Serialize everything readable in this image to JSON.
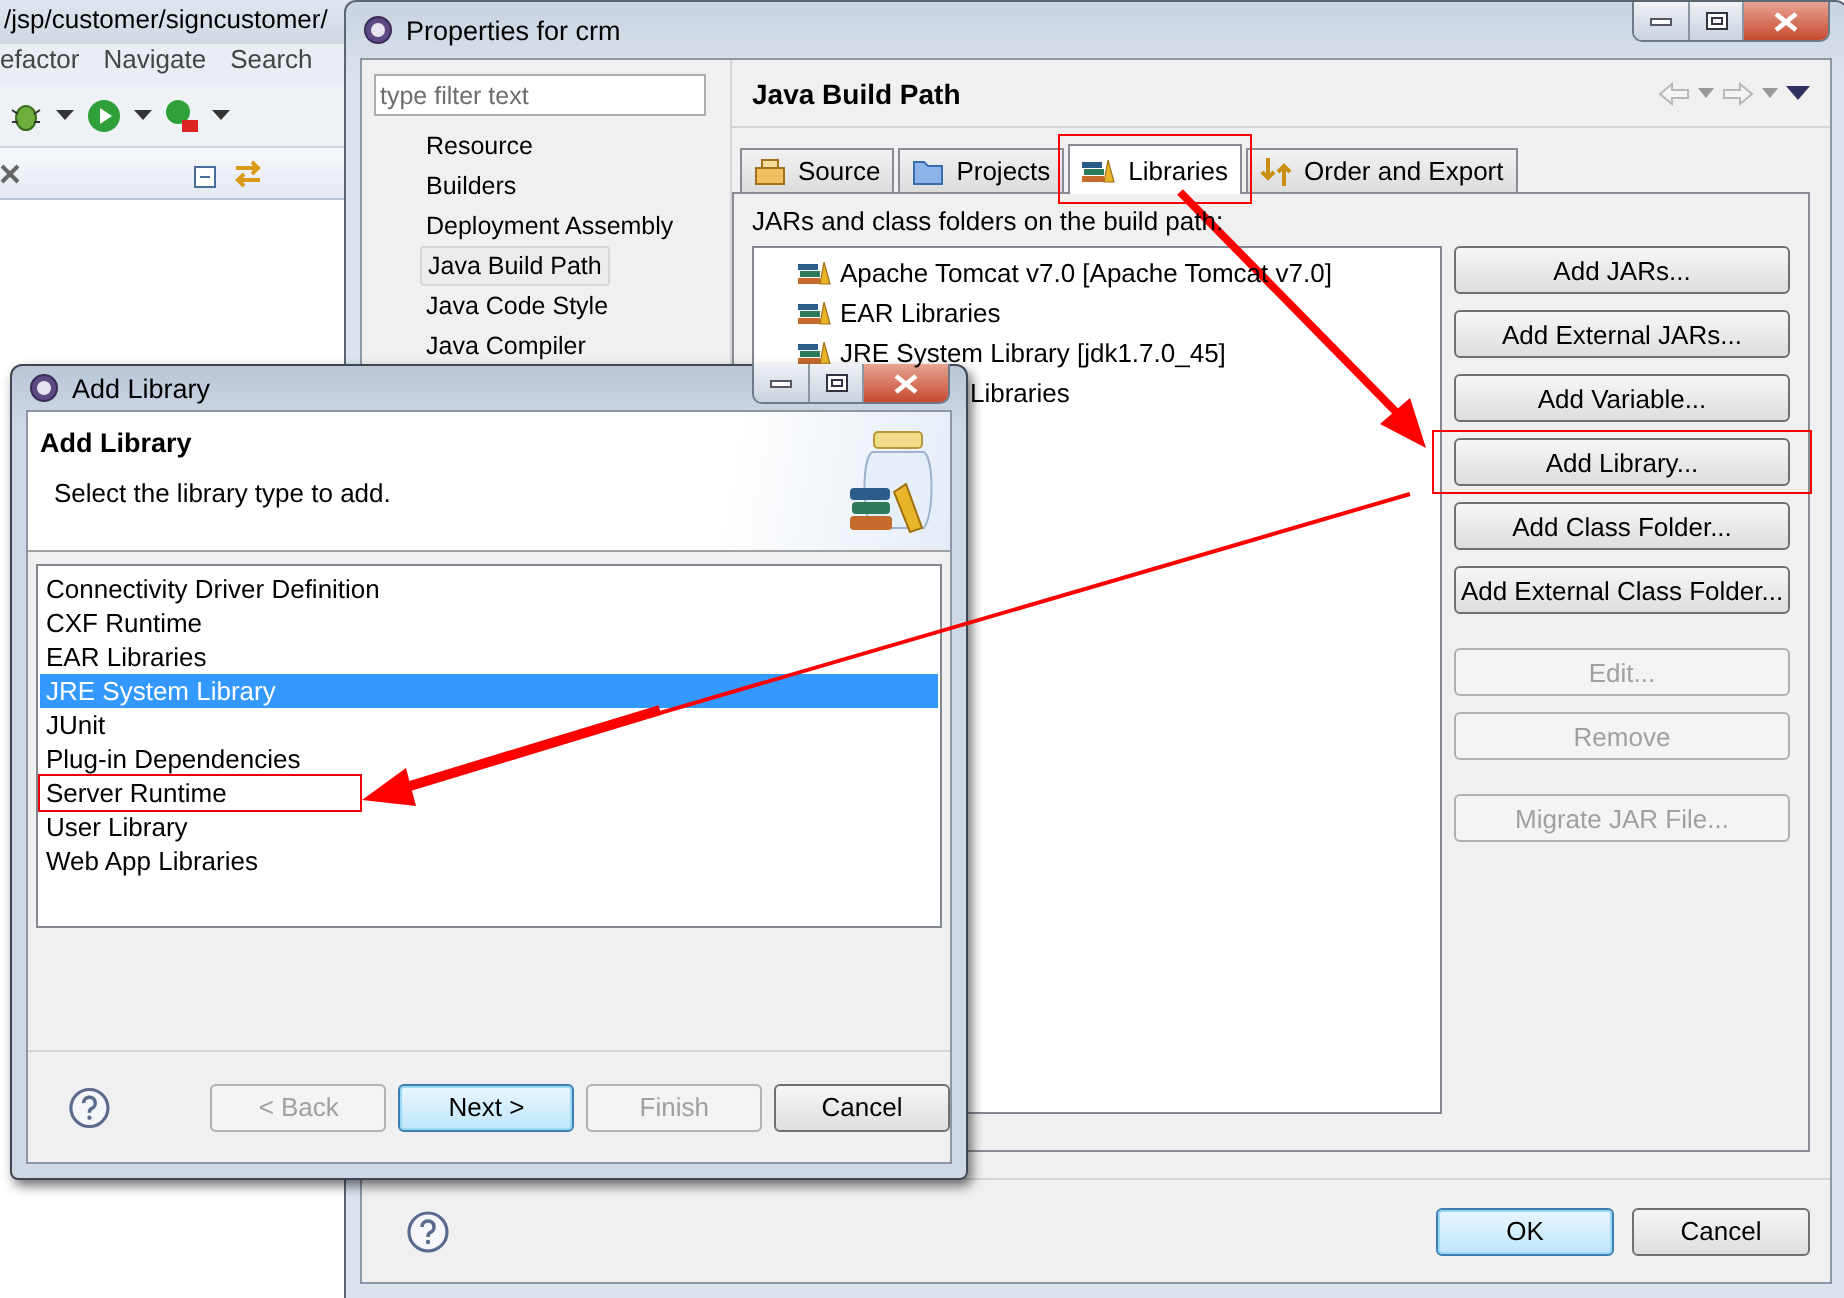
{
  "ide": {
    "path": "/jsp/customer/signcustomer/",
    "menu": [
      "efactor",
      "Navigate",
      "Search"
    ]
  },
  "properties_window": {
    "title": "Properties for crm",
    "filter": {
      "placeholder": "type filter text"
    },
    "nav_items": [
      {
        "label": "Resource",
        "selected": false
      },
      {
        "label": "Builders",
        "selected": false
      },
      {
        "label": "Deployment Assembly",
        "selected": false
      },
      {
        "label": "Java Build Path",
        "selected": true
      },
      {
        "label": "Java Code Style",
        "selected": false
      },
      {
        "label": "Java Compiler",
        "selected": false
      }
    ],
    "page_title": "Java Build Path",
    "tabs": [
      {
        "label": "Source",
        "kind": "source",
        "selected": false,
        "highlighted": false
      },
      {
        "label": "Projects",
        "kind": "projects",
        "selected": false,
        "highlighted": false
      },
      {
        "label": "Libraries",
        "kind": "libraries",
        "selected": true,
        "highlighted": true
      },
      {
        "label": "Order and Export",
        "kind": "order",
        "selected": false,
        "highlighted": false
      }
    ],
    "list_caption": "JARs and class folders on the build path:",
    "entries": [
      {
        "label": "Apache Tomcat v7.0 [Apache Tomcat v7.0]",
        "kind": "library"
      },
      {
        "label": "EAR Libraries",
        "kind": "library"
      },
      {
        "label": "JRE System Library [jdk1.7.0_45]",
        "kind": "library"
      },
      {
        "label": "Libraries",
        "kind": "covered"
      }
    ],
    "buttons": [
      {
        "label": "Add JARs...",
        "disabled": false,
        "highlighted": false
      },
      {
        "label": "Add External JARs...",
        "disabled": false,
        "highlighted": false
      },
      {
        "label": "Add Variable...",
        "disabled": false,
        "highlighted": false
      },
      {
        "label": "Add Library...",
        "disabled": false,
        "highlighted": true
      },
      {
        "label": "Add Class Folder...",
        "disabled": false,
        "highlighted": false
      },
      {
        "label": "Add External Class Folder...",
        "disabled": false,
        "highlighted": false
      },
      {
        "label": "Edit...",
        "disabled": true,
        "highlighted": false
      },
      {
        "label": "Remove",
        "disabled": true,
        "highlighted": false
      },
      {
        "label": "Migrate JAR File...",
        "disabled": true,
        "highlighted": false
      }
    ],
    "footer_buttons": [
      {
        "label": "OK",
        "default": true
      },
      {
        "label": "Cancel",
        "default": false
      }
    ]
  },
  "add_library_dialog": {
    "title": "Add Library",
    "heading": "Add Library",
    "description": "Select the library type to add.",
    "library_types": [
      {
        "label": "Connectivity Driver Definition",
        "selected": false,
        "highlighted": false
      },
      {
        "label": "CXF Runtime",
        "selected": false,
        "highlighted": false
      },
      {
        "label": "EAR Libraries",
        "selected": false,
        "highlighted": false
      },
      {
        "label": "JRE System Library",
        "selected": true,
        "highlighted": false
      },
      {
        "label": "JUnit",
        "selected": false,
        "highlighted": false
      },
      {
        "label": "Plug-in Dependencies",
        "selected": false,
        "highlighted": false
      },
      {
        "label": "Server Runtime",
        "selected": false,
        "highlighted": true
      },
      {
        "label": "User Library",
        "selected": false,
        "highlighted": false
      },
      {
        "label": "Web App Libraries",
        "selected": false,
        "highlighted": false
      }
    ],
    "buttons": [
      {
        "label": "< Back",
        "disabled": true,
        "default": false
      },
      {
        "label": "Next >",
        "disabled": false,
        "default": true
      },
      {
        "label": "Finish",
        "disabled": true,
        "default": false
      },
      {
        "label": "Cancel",
        "disabled": false,
        "default": false
      }
    ]
  }
}
